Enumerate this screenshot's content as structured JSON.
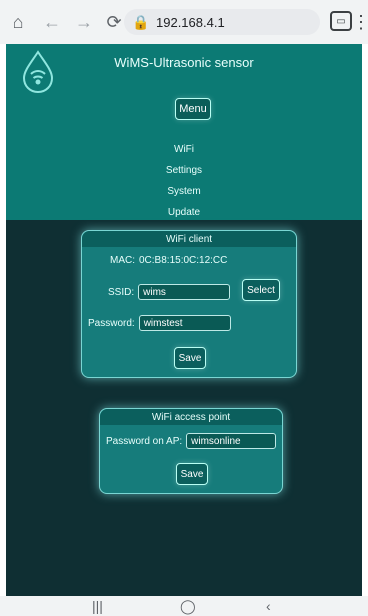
{
  "browser": {
    "url": "192.168.4.1",
    "icons": [
      "home-icon",
      "back-icon",
      "forward-icon",
      "reload-icon",
      "lock-icon",
      "tabs-icon",
      "more-icon"
    ]
  },
  "header": {
    "title": "WiMS-Ultrasonic sensor",
    "menu_label": "Menu",
    "nav": [
      "WiFi",
      "Settings",
      "System",
      "Update"
    ]
  },
  "wifi_client": {
    "title": "WiFi client",
    "mac_label": "MAC:",
    "mac_value": "0C:B8:15:0C:12:CC",
    "ssid_label": "SSID:",
    "ssid_value": "wims",
    "select_label": "Select",
    "password_label": "Password:",
    "password_value": "wimstest",
    "save_label": "Save"
  },
  "access_point": {
    "title": "WiFi access point",
    "password_label": "Password on AP:",
    "password_value": "wimsonline",
    "save_label": "Save"
  },
  "colors": {
    "header_teal": "#0c7a74",
    "page_dark": "#0f2f33",
    "card_teal": "#167c7b"
  }
}
